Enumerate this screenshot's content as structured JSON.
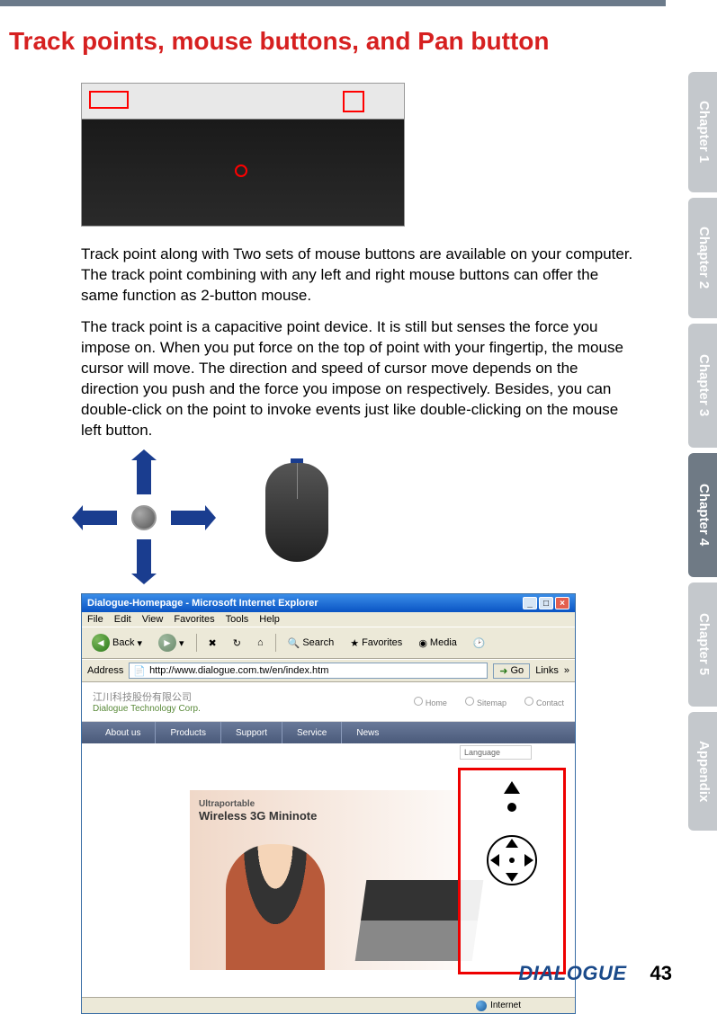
{
  "heading": "Track points, mouse buttons, and Pan button",
  "para1": "Track point along with Two sets of mouse buttons are available on your computer. The track point combining with any left and right mouse buttons can offer the same function as 2-button mouse.",
  "para2": "The track point is a capacitive point device. It is still but senses the force you impose on. When you put force on the top of point with your fingertip, the mouse cursor will move. The direction and speed of cursor move depends on the direction you push and the force you impose on respectively. Besides, you can double-click on the point to invoke events just like double-clicking on the mouse left button.",
  "browser": {
    "title": "Dialogue-Homepage - Microsoft Internet Explorer",
    "menu": {
      "file": "File",
      "edit": "Edit",
      "view": "View",
      "favorites": "Favorites",
      "tools": "Tools",
      "help": "Help"
    },
    "toolbar": {
      "back": "Back",
      "search": "Search",
      "favorites": "Favorites",
      "media": "Media"
    },
    "address": {
      "label": "Address",
      "url": "http://www.dialogue.com.tw/en/index.htm",
      "go": "Go",
      "links": "Links"
    },
    "page": {
      "logo_ch": "江川科技股份有限公司",
      "logo_en": "Dialogue Technology Corp.",
      "links": {
        "home": "Home",
        "sitemap": "Sitemap",
        "contact": "Contact"
      },
      "nav": {
        "about": "About us",
        "products": "Products",
        "support": "Support",
        "service": "Service",
        "news": "News"
      },
      "lang": "Language",
      "hero_t1": "Ultraportable",
      "hero_t2": "Wireless 3G Mininote"
    },
    "status": "Internet"
  },
  "tabs": {
    "ch1": "Chapter 1",
    "ch2": "Chapter 2",
    "ch3": "Chapter 3",
    "ch4": "Chapter 4",
    "ch5": "Chapter 5",
    "apx": "Appendix"
  },
  "footer": {
    "brand": "DIALOGUE",
    "page": "43"
  }
}
